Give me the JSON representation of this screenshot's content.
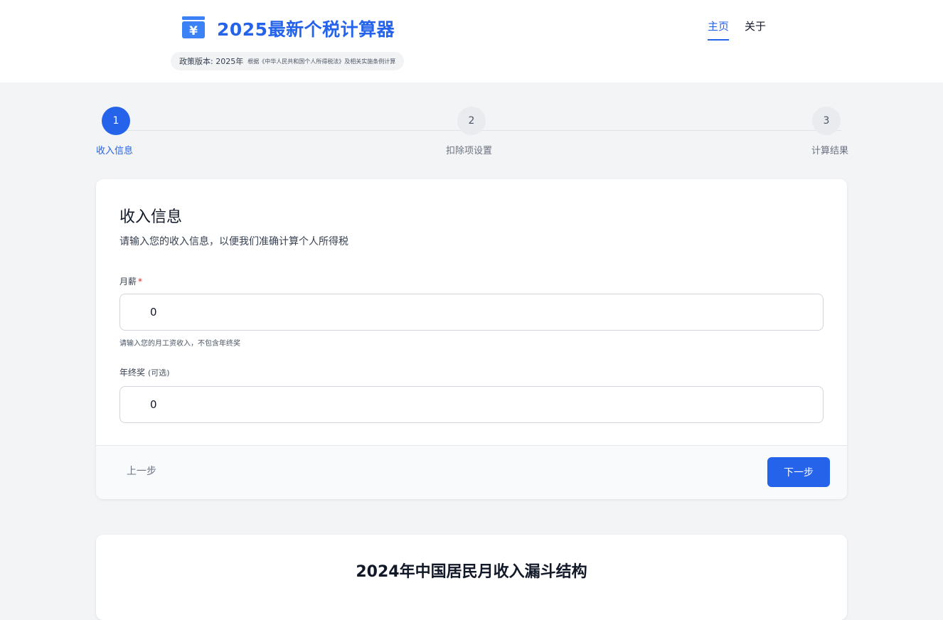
{
  "colors": {
    "accent": "#2563eb",
    "required": "#dc2626"
  },
  "header": {
    "title": "2025最新个税计算器",
    "logo_icon": "yen-wallet-icon",
    "policy_label": "政策版本: 2025年",
    "policy_desc": "根据《中华人民共和国个人所得税法》及相关实施条例计算"
  },
  "nav": {
    "items": [
      {
        "label": "主页",
        "active": true
      },
      {
        "label": "关于",
        "active": false
      }
    ]
  },
  "stepper": {
    "steps": [
      {
        "number": "1",
        "label": "收入信息",
        "state": "active"
      },
      {
        "number": "2",
        "label": "扣除项设置",
        "state": "todo"
      },
      {
        "number": "3",
        "label": "计算结果",
        "state": "todo"
      }
    ]
  },
  "form": {
    "title": "收入信息",
    "subtitle": "请输入您的收入信息，以便我们准确计算个人所得税",
    "salary": {
      "label": "月薪",
      "required_mark": "*",
      "value": "0",
      "help": "请输入您的月工资收入，不包含年终奖"
    },
    "bonus": {
      "label": "年终奖",
      "optional_note": "(可选)",
      "value": "0"
    },
    "prev_label": "上一步",
    "next_label": "下一步"
  },
  "funnel": {
    "title": "2024年中国居民月收入漏斗结构"
  }
}
